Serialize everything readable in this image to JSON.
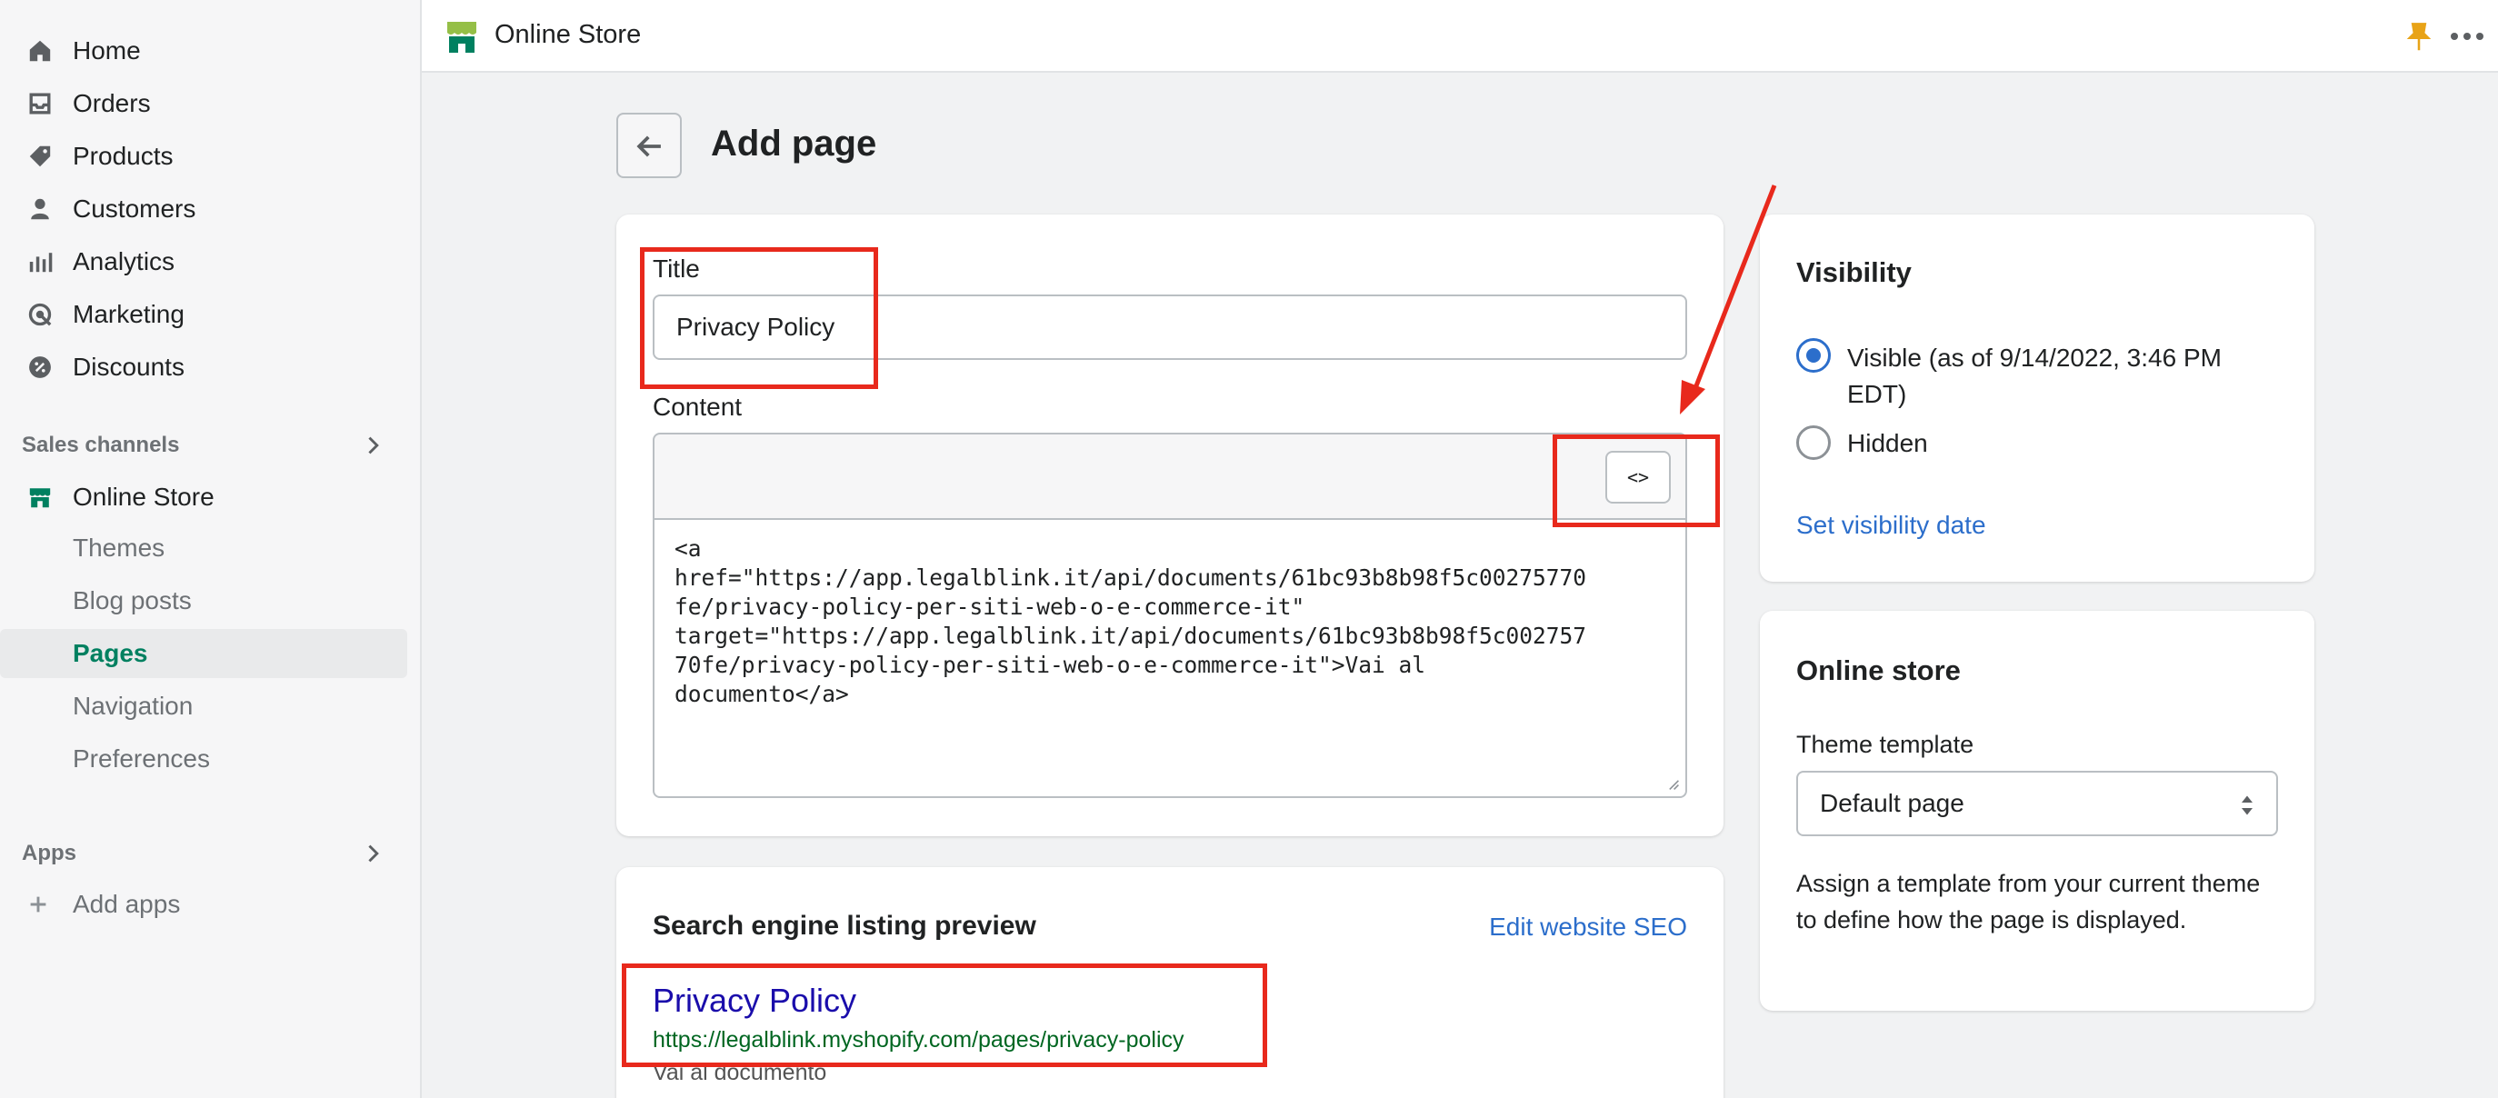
{
  "sidebar": {
    "items": [
      {
        "label": "Home",
        "icon": "home-icon"
      },
      {
        "label": "Orders",
        "icon": "inbox-icon"
      },
      {
        "label": "Products",
        "icon": "tag-icon"
      },
      {
        "label": "Customers",
        "icon": "person-icon"
      },
      {
        "label": "Analytics",
        "icon": "bar-chart-icon"
      },
      {
        "label": "Marketing",
        "icon": "target-icon"
      },
      {
        "label": "Discounts",
        "icon": "discount-icon"
      }
    ],
    "sales_channels_label": "Sales channels",
    "online_store_label": "Online Store",
    "online_store_subitems": [
      {
        "label": "Themes"
      },
      {
        "label": "Blog posts"
      },
      {
        "label": "Pages"
      },
      {
        "label": "Navigation"
      },
      {
        "label": "Preferences"
      }
    ],
    "apps_label": "Apps",
    "add_apps_label": "Add apps"
  },
  "topbar": {
    "title": "Online Store"
  },
  "page": {
    "title": "Add page"
  },
  "editor": {
    "title_label": "Title",
    "title_value": "Privacy Policy",
    "content_label": "Content",
    "html_toggle_label": "<>",
    "html_content": "<a\nhref=\"https://app.legalblink.it/api/documents/61bc93b8b98f5c00275770\nfe/privacy-policy-per-siti-web-o-e-commerce-it\"\ntarget=\"https://app.legalblink.it/api/documents/61bc93b8b98f5c002757\n70fe/privacy-policy-per-siti-web-o-e-commerce-it\">Vai al\ndocumento</a>"
  },
  "seo": {
    "heading": "Search engine listing preview",
    "edit_link": "Edit website SEO",
    "preview_title": "Privacy Policy",
    "preview_url": "https://legalblink.myshopify.com/pages/privacy-policy",
    "preview_description": "Vai al documento"
  },
  "visibility": {
    "heading": "Visibility",
    "visible_label": "Visible (as of 9/14/2022, 3:46 PM EDT)",
    "hidden_label": "Hidden",
    "set_date_link": "Set visibility date"
  },
  "online_store_card": {
    "heading": "Online store",
    "template_label": "Theme template",
    "template_value": "Default page",
    "help_text": "Assign a template from your current theme to define how the page is displayed."
  },
  "colors": {
    "accent": "#2c6ecb",
    "brand": "#008060",
    "annotation": "#e8291c"
  }
}
